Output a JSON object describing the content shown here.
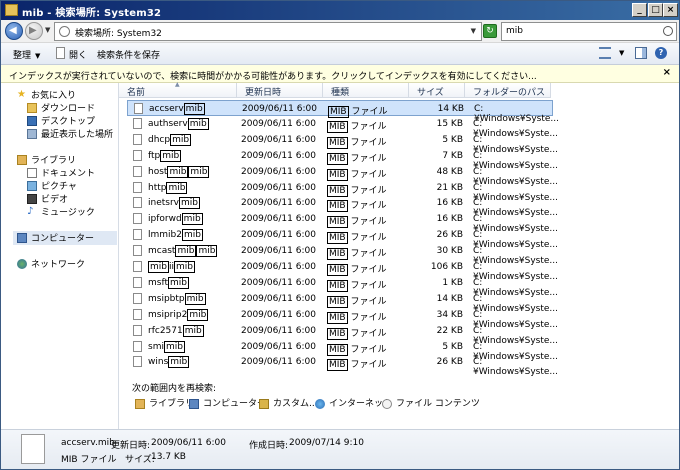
{
  "window": {
    "title": "mib - 検索場所: System32",
    "min_label": "_",
    "max_label": "□",
    "close_label": "×"
  },
  "address": {
    "path": "検索場所: System32",
    "search_value": "mib"
  },
  "commands": {
    "organize": "整理",
    "open": "開く",
    "save_search": "検索条件を保存"
  },
  "infobar": {
    "text": "インデックスが実行されていないので、検索に時間がかかる可能性があります。クリックしてインデックスを有効にしてください...",
    "close": "×"
  },
  "nav": {
    "favorites": "お気に入り",
    "downloads": "ダウンロード",
    "desktop": "デスクトップ",
    "recent": "最近表示した場所",
    "libraries": "ライブラリ",
    "documents": "ドキュメント",
    "pictures": "ピクチャ",
    "videos": "ビデオ",
    "music": "ミュージック",
    "computer": "コンピューター",
    "network": "ネットワーク"
  },
  "columns": {
    "name": "名前",
    "date": "更新日時",
    "type": "種類",
    "size": "サイズ",
    "path": "フォルダーのパス"
  },
  "files": [
    {
      "pre": "accserv",
      "hl": "mib",
      "post": "",
      "date": "2009/06/11 6:00",
      "type_hl": "MIB",
      "type_post": " ファイル",
      "size": "14 KB",
      "path": "C:¥Windows¥Syste..."
    },
    {
      "pre": "authserv",
      "hl": "mib",
      "post": "",
      "date": "2009/06/11 6:00",
      "type_hl": "MIB",
      "type_post": " ファイル",
      "size": "15 KB",
      "path": "C:¥Windows¥Syste..."
    },
    {
      "pre": "dhcp",
      "hl": "mib",
      "post": "",
      "date": "2009/06/11 6:00",
      "type_hl": "MIB",
      "type_post": " ファイル",
      "size": "5 KB",
      "path": "C:¥Windows¥Syste..."
    },
    {
      "pre": "ftp",
      "hl": "mib",
      "post": "",
      "date": "2009/06/11 6:00",
      "type_hl": "MIB",
      "type_post": " ファイル",
      "size": "7 KB",
      "path": "C:¥Windows¥Syste..."
    },
    {
      "pre": "host",
      "hl": "mib",
      "post": "",
      "pre2": "",
      "hl2": "mib",
      "date": "2009/06/11 6:00",
      "type_hl": "MIB",
      "type_post": " ファイル",
      "size": "48 KB",
      "path": "C:¥Windows¥Syste..."
    },
    {
      "pre": "http",
      "hl": "mib",
      "post": "",
      "date": "2009/06/11 6:00",
      "type_hl": "MIB",
      "type_post": " ファイル",
      "size": "21 KB",
      "path": "C:¥Windows¥Syste..."
    },
    {
      "pre": "inetsrv",
      "hl": "mib",
      "post": "",
      "date": "2009/06/11 6:00",
      "type_hl": "MIB",
      "type_post": " ファイル",
      "size": "16 KB",
      "path": "C:¥Windows¥Syste..."
    },
    {
      "pre": "ipforwd",
      "hl": "mib",
      "post": "",
      "date": "2009/06/11 6:00",
      "type_hl": "MIB",
      "type_post": " ファイル",
      "size": "16 KB",
      "path": "C:¥Windows¥Syste..."
    },
    {
      "pre": "lmmib2",
      "hl": "mib",
      "post": "",
      "date": "2009/06/11 6:00",
      "type_hl": "MIB",
      "type_post": " ファイル",
      "size": "26 KB",
      "path": "C:¥Windows¥Syste..."
    },
    {
      "pre": "mcast",
      "hl": "mib",
      "post": "",
      "pre2": "",
      "hl2": "mib",
      "date": "2009/06/11 6:00",
      "type_hl": "MIB",
      "type_post": " ファイル",
      "size": "30 KB",
      "path": "C:¥Windows¥Syste..."
    },
    {
      "pre": "",
      "hl": "mib",
      "post": "ii",
      "pre2": "",
      "hl2": "mib",
      "date": "2009/06/11 6:00",
      "type_hl": "MIB",
      "type_post": " ファイル",
      "size": "106 KB",
      "path": "C:¥Windows¥Syste..."
    },
    {
      "pre": "msft",
      "hl": "mib",
      "post": "",
      "date": "2009/06/11 6:00",
      "type_hl": "MIB",
      "type_post": " ファイル",
      "size": "1 KB",
      "path": "C:¥Windows¥Syste..."
    },
    {
      "pre": "msipbtp",
      "hl": "mib",
      "post": "",
      "date": "2009/06/11 6:00",
      "type_hl": "MIB",
      "type_post": " ファイル",
      "size": "14 KB",
      "path": "C:¥Windows¥Syste..."
    },
    {
      "pre": "msiprip2",
      "hl": "mib",
      "post": "",
      "date": "2009/06/11 6:00",
      "type_hl": "MIB",
      "type_post": " ファイル",
      "size": "34 KB",
      "path": "C:¥Windows¥Syste..."
    },
    {
      "pre": "rfc2571",
      "hl": "mib",
      "post": "",
      "date": "2009/06/11 6:00",
      "type_hl": "MIB",
      "type_post": " ファイル",
      "size": "22 KB",
      "path": "C:¥Windows¥Syste..."
    },
    {
      "pre": "smi",
      "hl": "mib",
      "post": "",
      "date": "2009/06/11 6:00",
      "type_hl": "MIB",
      "type_post": " ファイル",
      "size": "5 KB",
      "path": "C:¥Windows¥Syste..."
    },
    {
      "pre": "wins",
      "hl": "mib",
      "post": "",
      "date": "2009/06/11 6:00",
      "type_hl": "MIB",
      "type_post": " ファイル",
      "size": "26 KB",
      "path": "C:¥Windows¥Syste..."
    }
  ],
  "research": {
    "title": "次の範囲内を再検索:",
    "library": "ライブラリ",
    "computer": "コンピューター",
    "custom": "カスタム...",
    "internet": "インターネット",
    "file_contents": "ファイル コンテンツ"
  },
  "details": {
    "filename": "accserv.mib",
    "modified_label": "更新日時:",
    "modified_value": "2009/06/11 6:00",
    "created_label": "作成日時:",
    "created_value": "2009/07/14 9:10",
    "type": "MIB ファイル",
    "size_label": "サイズ:",
    "size_value": "13.7 KB"
  },
  "colors": {
    "selection": "#cfe3fb",
    "infobar": "#ffffe1",
    "titlebar": "#0a246a"
  }
}
